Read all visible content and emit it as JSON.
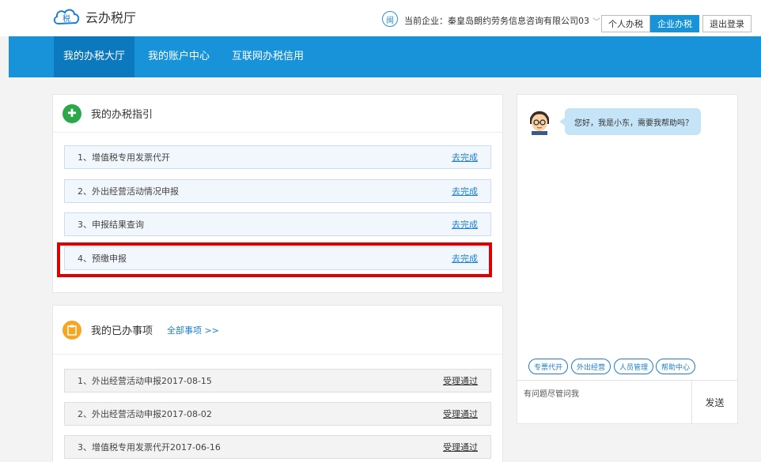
{
  "header": {
    "app_name": "云办税厅",
    "logo_text": "税",
    "company_icon": "闽",
    "company_label": "当前企业：秦皇岛朗约劳务信息咨询有限公司03",
    "chevron": "﹀",
    "personal_tax": "个人办税",
    "enterprise_tax": "企业办税",
    "logout": "退出登录"
  },
  "nav": {
    "items": [
      {
        "label": "我的办税大厅"
      },
      {
        "label": "我的账户中心"
      },
      {
        "label": "互联网办税信用"
      }
    ]
  },
  "guide": {
    "title": "我的办税指引",
    "icon": "✚",
    "items": [
      {
        "label": "1、增值税专用发票代开",
        "action": "去完成"
      },
      {
        "label": "2、外出经营活动情况申报",
        "action": "去完成"
      },
      {
        "label": "3、申报结果查询",
        "action": "去完成"
      },
      {
        "label": "4、预缴申报",
        "action": "去完成"
      }
    ]
  },
  "done": {
    "title": "我的已办事项",
    "all_link": "全部事项 >>",
    "items": [
      {
        "label": "1、外出经营活动申报2017-08-15",
        "status": "受理通过"
      },
      {
        "label": "2、外出经营活动申报2017-08-02",
        "status": "受理通过"
      },
      {
        "label": "3、增值税专用发票代开2017-06-16",
        "status": "受理通过"
      }
    ]
  },
  "chat": {
    "greeting": "您好，我是小东，需要我帮助吗？",
    "quick_buttons": [
      "专票代开",
      "外出经营",
      "人员管理",
      "帮助中心"
    ],
    "input_placeholder": "有问题尽管问我",
    "send": "发送"
  },
  "colors": {
    "brand_blue": "#1893d9",
    "highlight_red": "#e00000"
  }
}
